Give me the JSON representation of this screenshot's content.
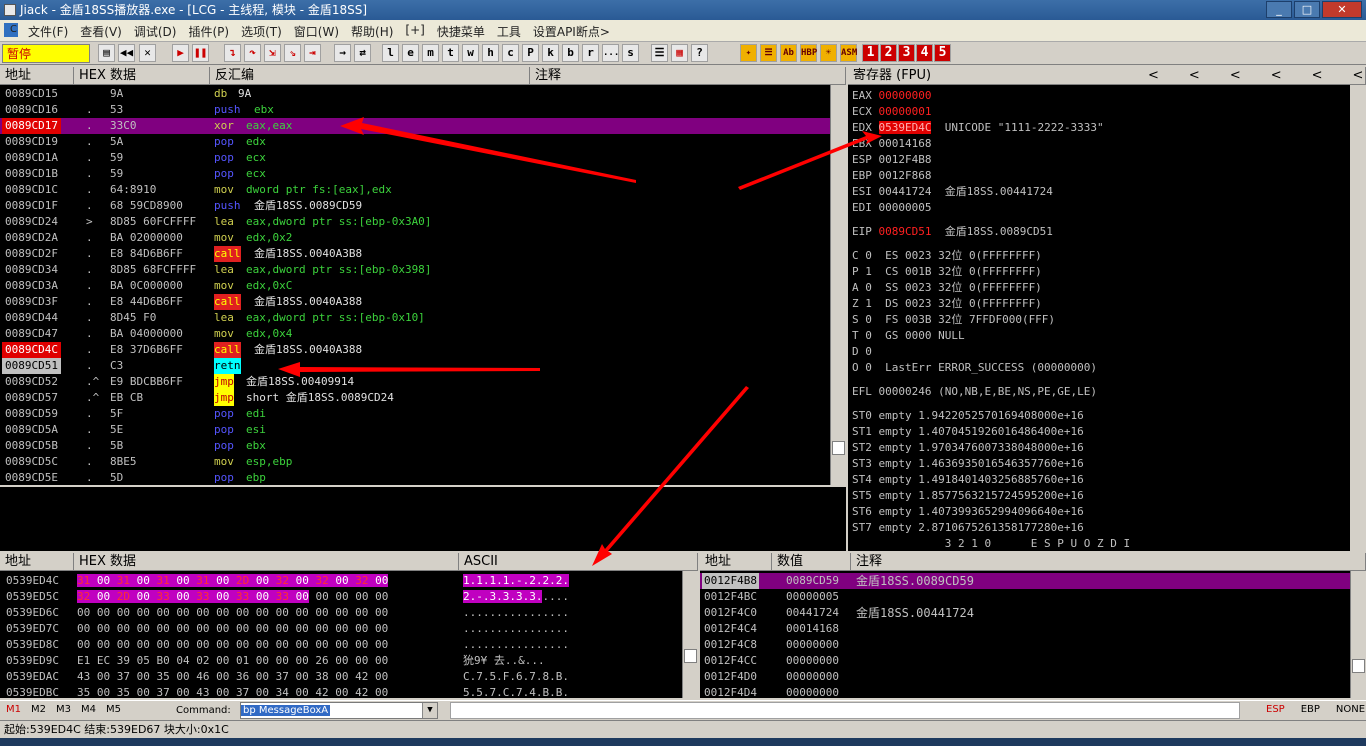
{
  "window": {
    "title": "Jiack  - 金盾18SS播放器.exe - [LCG - 主线程, 模块 - 金盾18SS]"
  },
  "menu": [
    "文件(F)",
    "查看(V)",
    "调试(D)",
    "插件(P)",
    "选项(T)",
    "窗口(W)",
    "帮助(H)",
    "[+]",
    "快捷菜单",
    "工具",
    "设置API断点>"
  ],
  "plugin_buttons": [
    "BP",
    "P",
    "VB",
    "Notepad",
    "Calc",
    "Folder",
    "CMD",
    "Exit"
  ],
  "toolbar": {
    "state": "暂停",
    "letters": [
      "l",
      "e",
      "m",
      "t",
      "w",
      "h",
      "c",
      "P",
      "k",
      "b",
      "r",
      "...",
      "s"
    ],
    "numbers": [
      "1",
      "2",
      "3",
      "4",
      "5"
    ]
  },
  "disasm": {
    "headers": [
      "地址",
      "HEX 数据",
      "反汇编",
      "注释"
    ],
    "rows": [
      {
        "addr": "0089CD15",
        "mark": "",
        "hex": "9A",
        "mnem": "db",
        "ops": "9A",
        "style": "db"
      },
      {
        "addr": "0089CD16",
        "mark": ".",
        "hex": "53",
        "mnem": "push",
        "ops": "ebx",
        "style": "blue"
      },
      {
        "addr": "0089CD17",
        "mark": ".",
        "hex": "33C0",
        "mnem": "xor",
        "ops": "eax,eax",
        "style": "sel"
      },
      {
        "addr": "0089CD19",
        "mark": ".",
        "hex": "5A",
        "mnem": "pop",
        "ops": "edx",
        "style": "blue"
      },
      {
        "addr": "0089CD1A",
        "mark": ".",
        "hex": "59",
        "mnem": "pop",
        "ops": "ecx",
        "style": "blue"
      },
      {
        "addr": "0089CD1B",
        "mark": ".",
        "hex": "59",
        "mnem": "pop",
        "ops": "ecx",
        "style": "blue"
      },
      {
        "addr": "0089CD1C",
        "mark": ".",
        "hex": "64:8910",
        "mnem": "mov",
        "ops": "dword ptr fs:[eax],edx",
        "style": "ptr"
      },
      {
        "addr": "0089CD1F",
        "mark": ".",
        "hex": "68 59CD8900",
        "mnem": "push",
        "ops": "金盾18SS.0089CD59",
        "style": "blue"
      },
      {
        "addr": "0089CD24",
        "mark": ">",
        "hex": "8D85 60FCFFFF",
        "mnem": "lea",
        "ops": "eax,dword ptr ss:[ebp-0x3A0]",
        "style": "ptr"
      },
      {
        "addr": "0089CD2A",
        "mark": ".",
        "hex": "BA 02000000",
        "mnem": "mov",
        "ops": "edx,0x2",
        "style": "imm"
      },
      {
        "addr": "0089CD2F",
        "mark": ".",
        "hex": "E8 84D6B6FF",
        "mnem": "call",
        "ops": "金盾18SS.0040A3B8",
        "style": "call"
      },
      {
        "addr": "0089CD34",
        "mark": ".",
        "hex": "8D85 68FCFFFF",
        "mnem": "lea",
        "ops": "eax,dword ptr ss:[ebp-0x398]",
        "style": "ptr"
      },
      {
        "addr": "0089CD3A",
        "mark": ".",
        "hex": "BA 0C000000",
        "mnem": "mov",
        "ops": "edx,0xC",
        "style": "imm"
      },
      {
        "addr": "0089CD3F",
        "mark": ".",
        "hex": "E8 44D6B6FF",
        "mnem": "call",
        "ops": "金盾18SS.0040A388",
        "style": "call"
      },
      {
        "addr": "0089CD44",
        "mark": ".",
        "hex": "8D45 F0",
        "mnem": "lea",
        "ops": "eax,dword ptr ss:[ebp-0x10]",
        "style": "ptr"
      },
      {
        "addr": "0089CD47",
        "mark": ".",
        "hex": "BA 04000000",
        "mnem": "mov",
        "ops": "edx,0x4",
        "style": "imm"
      },
      {
        "addr": "0089CD4C",
        "mark": ".",
        "hex": "E8 37D6B6FF",
        "mnem": "call",
        "ops": "金盾18SS.0040A388",
        "style": "call",
        "addrRed": true
      },
      {
        "addr": "0089CD51",
        "mark": ".",
        "hex": "C3",
        "mnem": "retn",
        "ops": "",
        "style": "retn",
        "addrGray": true
      },
      {
        "addr": "0089CD52",
        "mark": ".^",
        "hex": "E9 BDCBB6FF",
        "mnem": "jmp",
        "ops": "金盾18SS.00409914",
        "style": "jmp"
      },
      {
        "addr": "0089CD57",
        "mark": ".^",
        "hex": "EB CB",
        "mnem": "jmp",
        "ops": "short 金盾18SS.0089CD24",
        "style": "jmp"
      },
      {
        "addr": "0089CD59",
        "mark": ".",
        "hex": "5F",
        "mnem": "pop",
        "ops": "edi",
        "style": "blue"
      },
      {
        "addr": "0089CD5A",
        "mark": ".",
        "hex": "5E",
        "mnem": "pop",
        "ops": "esi",
        "style": "blue"
      },
      {
        "addr": "0089CD5B",
        "mark": ".",
        "hex": "5B",
        "mnem": "pop",
        "ops": "ebx",
        "style": "blue"
      },
      {
        "addr": "0089CD5C",
        "mark": ".",
        "hex": "8BE5",
        "mnem": "mov",
        "ops": "esp,ebp",
        "style": "plain"
      },
      {
        "addr": "0089CD5E",
        "mark": ".",
        "hex": "5D",
        "mnem": "pop",
        "ops": "ebp",
        "style": "blue"
      }
    ]
  },
  "registers": {
    "header": "寄存器 (FPU)",
    "nav": [
      "<",
      "<",
      "<",
      "<",
      "<",
      "<"
    ],
    "lines": [
      {
        "t": "EAX 00000000",
        "y": 0,
        "val_red": true
      },
      {
        "t": "ECX 00000001",
        "y": 1,
        "val_red": true
      },
      {
        "t": "EDX 0539ED4C",
        "y": 2,
        "val_sel": true,
        "extra": "UNICODE \"1111-2222-3333\""
      },
      {
        "t": "EBX 00014168",
        "y": 3
      },
      {
        "t": "ESP 0012F4B8",
        "y": 4
      },
      {
        "t": "EBP 0012F868",
        "y": 5
      },
      {
        "t": "ESI 00441724",
        "y": 6,
        "extra": "金盾18SS.00441724"
      },
      {
        "t": "EDI 00000005",
        "y": 7
      },
      {
        "t": "EIP 0089CD51",
        "y": 8.5,
        "val_red": true,
        "extra": "金盾18SS.0089CD51"
      },
      {
        "t": "C 0  ES 0023 32位 0(FFFFFFFF)",
        "y": 10
      },
      {
        "t": "P 1  CS 001B 32位 0(FFFFFFFF)",
        "y": 11
      },
      {
        "t": "A 0  SS 0023 32位 0(FFFFFFFF)",
        "y": 12
      },
      {
        "t": "Z 1  DS 0023 32位 0(FFFFFFFF)",
        "y": 13
      },
      {
        "t": "S 0  FS 003B 32位 7FFDF000(FFF)",
        "y": 14
      },
      {
        "t": "T 0  GS 0000 NULL",
        "y": 15
      },
      {
        "t": "D 0",
        "y": 16
      },
      {
        "t": "O 0  LastErr ERROR_SUCCESS (00000000)",
        "y": 17
      },
      {
        "t": "EFL 00000246 (NO,NB,E,BE,NS,PE,GE,LE)",
        "y": 18.5
      },
      {
        "t": "ST0 empty 1.9422052570169408000e+16",
        "y": 20
      },
      {
        "t": "ST1 empty 1.4070451926016486400e+16",
        "y": 21
      },
      {
        "t": "ST2 empty 1.9703476007338048000e+16",
        "y": 22
      },
      {
        "t": "ST3 empty 1.4636935016546357760e+16",
        "y": 23
      },
      {
        "t": "ST4 empty 1.4918401403256885760e+16",
        "y": 24
      },
      {
        "t": "ST5 empty 1.8577563215724595200e+16",
        "y": 25
      },
      {
        "t": "ST6 empty 1.4073993652994096640e+16",
        "y": 26
      },
      {
        "t": "ST7 empty 2.8710675261358177280e+16",
        "y": 27
      },
      {
        "t": "              3 2 1 0      E S P U O Z D I",
        "y": 28
      }
    ]
  },
  "dump": {
    "headers": [
      "地址",
      "HEX 数据",
      "ASCII"
    ],
    "rows": [
      {
        "addr": "0539ED4C",
        "hex": "31 00 31 00 31 00 31 00 2D 00 32 00 32 00 32 00",
        "ascii": "1.1.1.1.-.2.2.2.",
        "selHex": 16,
        "selAsc": 16
      },
      {
        "addr": "0539ED5C",
        "hex": "32 00 2D 00 33 00 33 00 33 00 33 00 00 00 00 00",
        "ascii": "2.-.3.3.3.3.....",
        "selHex": 12,
        "selAsc": 12
      },
      {
        "addr": "0539ED6C",
        "hex": "00 00 00 00 00 00 00 00 00 00 00 00 00 00 00 00",
        "ascii": "................"
      },
      {
        "addr": "0539ED7C",
        "hex": "00 00 00 00 00 00 00 00 00 00 00 00 00 00 00 00",
        "ascii": "................"
      },
      {
        "addr": "0539ED8C",
        "hex": "00 00 00 00 00 00 00 00 00 00 00 00 00 00 00 00",
        "ascii": "................"
      },
      {
        "addr": "0539ED9C",
        "hex": "E1 EC 39 05 B0 04 02 00 01 00 00 00 26 00 00 00",
        "ascii": "狁9¥ ̄去..&..."
      },
      {
        "addr": "0539EDAC",
        "hex": "43 00 37 00 35 00 46 00 36 00 37 00 38 00 42 00",
        "ascii": "C.7.5.F.6.7.8.B."
      },
      {
        "addr": "0539EDBC",
        "hex": "35 00 35 00 37 00 43 00 37 00 34 00 42 00 42 00",
        "ascii": "5.5.7.C.7.4.B.B."
      }
    ]
  },
  "stack": {
    "headers": [
      "地址",
      "数值",
      "注释"
    ],
    "rows": [
      {
        "addr": "0012F4B8",
        "val": "0089CD59",
        "comment": "金盾18SS.0089CD59",
        "sel": true
      },
      {
        "addr": "0012F4BC",
        "val": "00000005",
        "comment": ""
      },
      {
        "addr": "0012F4C0",
        "val": "00441724",
        "comment": "金盾18SS.00441724"
      },
      {
        "addr": "0012F4C4",
        "val": "00014168",
        "comment": ""
      },
      {
        "addr": "0012F4C8",
        "val": "00000000",
        "comment": ""
      },
      {
        "addr": "0012F4CC",
        "val": "00000000",
        "comment": ""
      },
      {
        "addr": "0012F4D0",
        "val": "00000000",
        "comment": ""
      },
      {
        "addr": "0012F4D4",
        "val": "00000000",
        "comment": ""
      }
    ]
  },
  "command": {
    "tabs": [
      "M1",
      "M2",
      "M3",
      "M4",
      "M5"
    ],
    "label": "Command:",
    "value": "bp MessageBoxA",
    "right": [
      "ESP",
      "EBP",
      "NONE"
    ]
  },
  "status": "起始:539ED4C 结束:539ED67 块大小:0x1C"
}
